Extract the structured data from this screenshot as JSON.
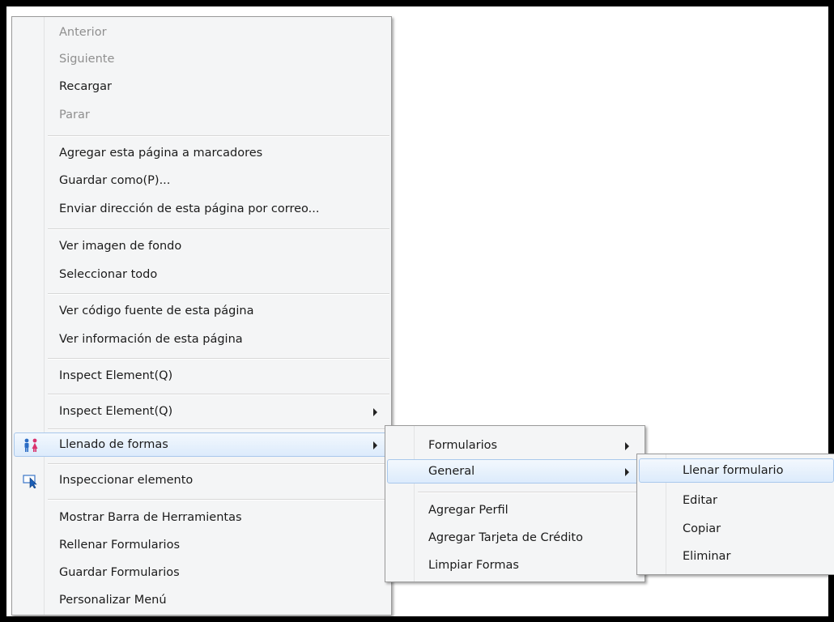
{
  "main_menu": {
    "items": [
      {
        "label": "Anterior",
        "disabled": true
      },
      {
        "label": "Siguiente",
        "disabled": true
      },
      {
        "label": "Recargar",
        "disabled": false
      },
      {
        "label": "Parar",
        "disabled": true
      },
      {
        "label": "Agregar esta página a marcadores"
      },
      {
        "label": "Guardar como(P)..."
      },
      {
        "label": "Enviar dirección de esta página por correo..."
      },
      {
        "label": "Ver imagen de fondo"
      },
      {
        "label": "Seleccionar todo"
      },
      {
        "label": "Ver código fuente de esta página"
      },
      {
        "label": "Ver información de esta página"
      },
      {
        "label": "Inspect Element(Q)"
      },
      {
        "label": "Inspect Element(Q)",
        "submenu": true
      },
      {
        "label": "Llenado de formas",
        "submenu": true,
        "icon": "people-icon",
        "highlighted": true
      },
      {
        "label": "Inspeccionar elemento",
        "icon": "inspect-cursor-icon"
      },
      {
        "label": "Mostrar Barra de Herramientas"
      },
      {
        "label": "Rellenar Formularios"
      },
      {
        "label": "Guardar Formularios"
      },
      {
        "label": "Personalizar Menú"
      }
    ]
  },
  "submenu_forms": {
    "items": [
      {
        "label": "Formularios",
        "submenu": true
      },
      {
        "label": "General",
        "submenu": true,
        "highlighted": true
      },
      {
        "label": "Agregar Perfil"
      },
      {
        "label": "Agregar Tarjeta de Crédito"
      },
      {
        "label": "Limpiar Formas"
      }
    ]
  },
  "submenu_general": {
    "items": [
      {
        "label": "Llenar formulario",
        "highlighted": true
      },
      {
        "label": "Editar"
      },
      {
        "label": "Copiar"
      },
      {
        "label": "Eliminar"
      }
    ]
  },
  "colors": {
    "menu_background": "#f4f5f6",
    "highlight": "#dcebfc",
    "highlight_border": "#a9c8ec",
    "disabled_text": "#8f8f8f"
  }
}
